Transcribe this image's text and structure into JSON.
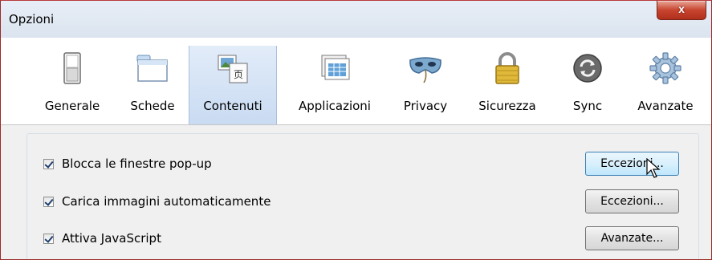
{
  "window": {
    "title": "Opzioni",
    "close_symbol": "x"
  },
  "toolbar": {
    "selected": "Contenuti",
    "tabs": [
      {
        "label": "Generale",
        "icon": "switch-icon"
      },
      {
        "label": "Schede",
        "icon": "tabs-window-icon"
      },
      {
        "label": "Contenuti",
        "icon": "content-media-icon"
      },
      {
        "label": "Applicazioni",
        "icon": "applications-window-icon"
      },
      {
        "label": "Privacy",
        "icon": "privacy-mask-icon"
      },
      {
        "label": "Sicurezza",
        "icon": "padlock-icon"
      },
      {
        "label": "Sync",
        "icon": "sync-icon"
      },
      {
        "label": "Avanzate",
        "icon": "gear-icon"
      }
    ]
  },
  "content": {
    "options": [
      {
        "label": "Blocca le finestre pop-up",
        "checked": true,
        "button": "Eccezioni..."
      },
      {
        "label": "Carica immagini automaticamente",
        "checked": true,
        "button": "Eccezioni..."
      },
      {
        "label": "Attiva JavaScript",
        "checked": true,
        "button": "Avanzate..."
      }
    ]
  },
  "colors": {
    "selected_tab": "#c9dbf2",
    "close_button": "#c8452f",
    "checkmark": "#1e3f70"
  }
}
